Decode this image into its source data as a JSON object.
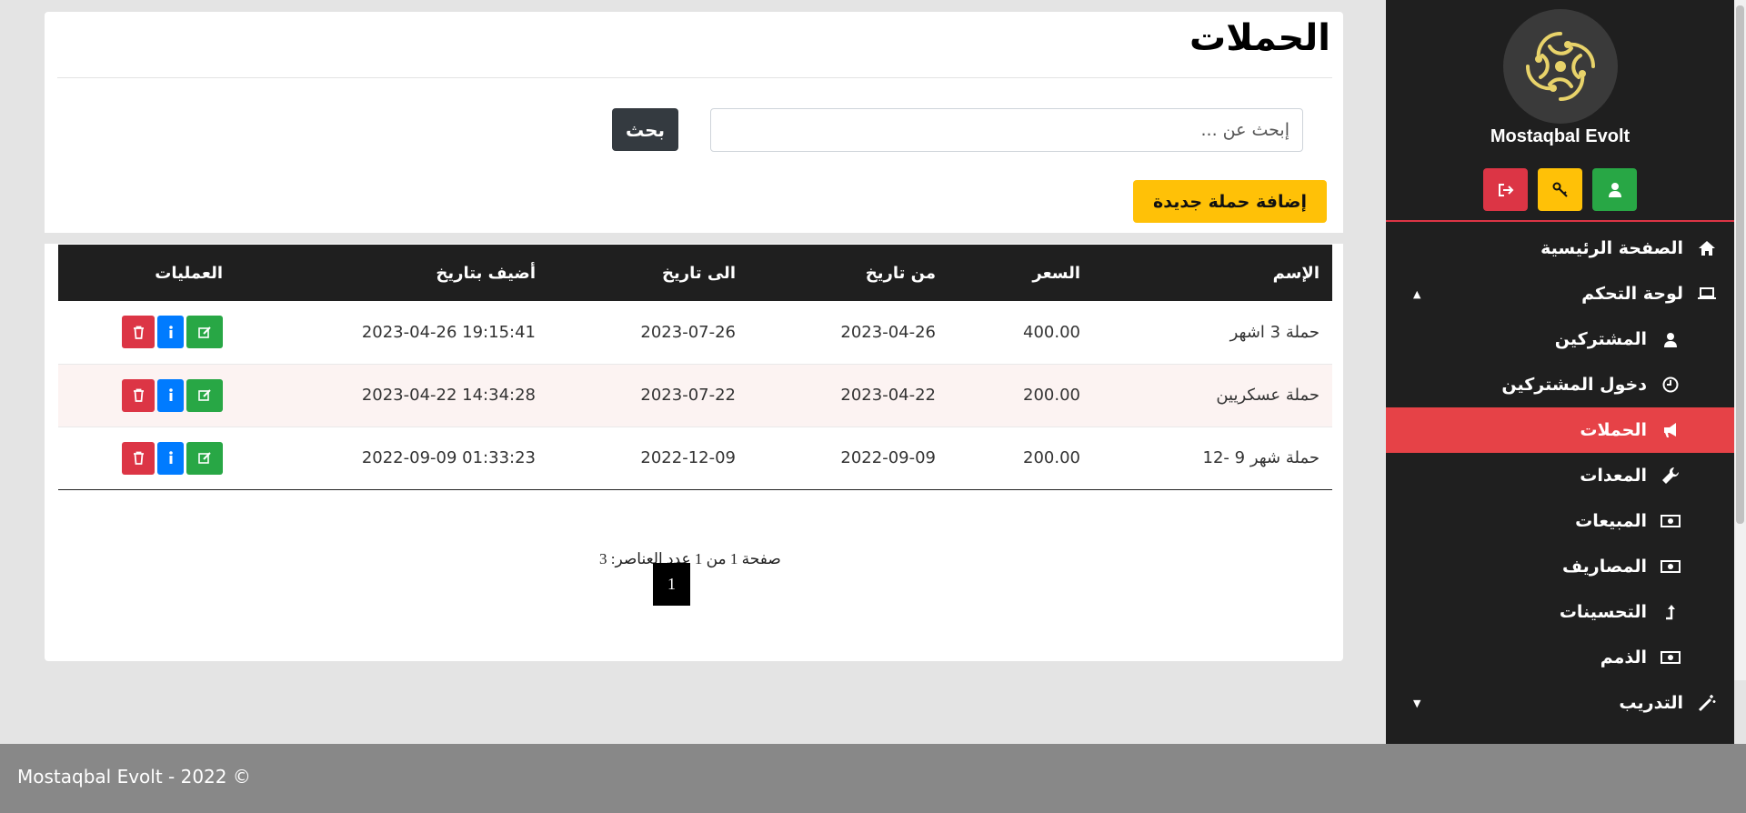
{
  "brand": {
    "name": "Mostaqbal Evolt"
  },
  "quick_actions": [
    {
      "name": "logout",
      "icon": "sign-out-icon",
      "color": "#dc3545"
    },
    {
      "name": "key",
      "icon": "key-icon",
      "color": "#ffc107"
    },
    {
      "name": "profile",
      "icon": "user-icon",
      "color": "#28a745"
    }
  ],
  "sidebar": {
    "items": [
      {
        "label": "الصفحة الرئيسية",
        "icon": "home-icon",
        "level": "top"
      },
      {
        "label": "لوحة التحكم",
        "icon": "laptop-icon",
        "level": "top",
        "caret": "▲"
      },
      {
        "label": "المشتركين",
        "icon": "user-icon",
        "level": "sub"
      },
      {
        "label": "دخول المشتركين",
        "icon": "clock-icon",
        "level": "sub"
      },
      {
        "label": "الحملات",
        "icon": "bullhorn-icon",
        "level": "sub",
        "active": true
      },
      {
        "label": "المعدات",
        "icon": "wrench-icon",
        "level": "sub"
      },
      {
        "label": "المبيعات",
        "icon": "money-icon",
        "level": "sub"
      },
      {
        "label": "المصاريف",
        "icon": "money-icon",
        "level": "sub"
      },
      {
        "label": "التحسينات",
        "icon": "level-up-icon",
        "level": "sub"
      },
      {
        "label": "الذمم",
        "icon": "money-icon",
        "level": "sub"
      },
      {
        "label": "التدريب",
        "icon": "magic-wand-icon",
        "level": "top",
        "caret": "▼"
      }
    ]
  },
  "page": {
    "title": "الحملات",
    "search_placeholder": "إبحث عن ...",
    "search_button": "بحث",
    "add_button": "إضافة حملة جديدة"
  },
  "table": {
    "columns": [
      "الإسم",
      "السعر",
      "من تاريخ",
      "الى تاريخ",
      "أضيف بتاريخ",
      "العمليات"
    ],
    "rows": [
      {
        "name": "حملة 3 اشهر",
        "price": "400.00",
        "from": "2023-04-26",
        "to": "2023-07-26",
        "added": "2023-04-26 19:15:41"
      },
      {
        "name": "حملة عسكريين",
        "price": "200.00",
        "from": "2023-04-22",
        "to": "2023-07-22",
        "added": "2023-04-22 14:34:28"
      },
      {
        "name": "حملة شهر 9 -12",
        "price": "200.00",
        "from": "2022-09-09",
        "to": "2022-12-09",
        "added": "2022-09-09 01:33:23"
      }
    ]
  },
  "pagination": {
    "summary": "صفحة 1 من 1 عدد العناصر: 3",
    "current": "1"
  },
  "footer": {
    "text": "Mostaqbal Evolt - 2022 ©"
  },
  "colors": {
    "sidebar_bg": "#1f1f1f",
    "active_item": "#e64247",
    "accent_yellow": "#ffc107"
  }
}
